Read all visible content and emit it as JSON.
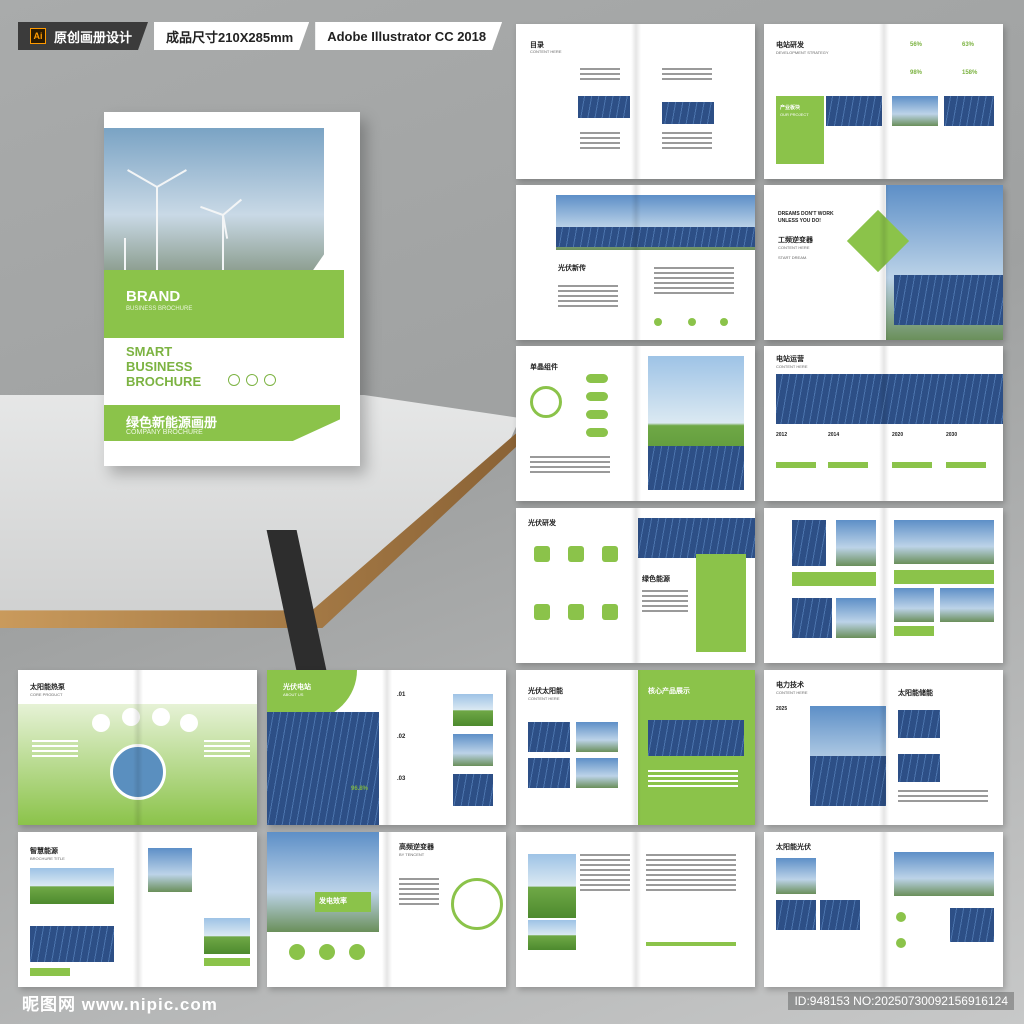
{
  "header": {
    "software_badge": "Ai",
    "tag_design": "原创画册设计",
    "tag_size": "成品尺寸210X285mm",
    "tag_software": "Adobe Illustrator CC 2018"
  },
  "cover": {
    "brand": "BRAND",
    "brand_sub": "BUSINESS BROCHURE",
    "title": "SMART BUSINESS BROCHURE",
    "title_cn": "绿色新能源画册",
    "title_cn_sub": "COMPANY BROCHURE"
  },
  "spreads": {
    "contents": {
      "title": "目录",
      "sub": "CONTENT HERE"
    },
    "research": {
      "title": "电站研发",
      "sub": "DEVELOPMENT STRATEGY",
      "pct1": "56%",
      "pct2": "63%",
      "pct3": "98%",
      "pct4": "158%",
      "project": "产业板块",
      "project_sub": "OUR PROJECT"
    },
    "culture": {
      "title": "光伏新传",
      "sub": "CORPORATE CULTURE"
    },
    "dreams": {
      "line1": "DREAMS DON'T WORK",
      "line2": "UNLESS YOU DO!",
      "title": "工频逆变器",
      "sub": "CONTENT HERE",
      "tail": "START DREAM."
    },
    "brand_org": {
      "title": "单晶组件",
      "sub1": "ENTERPISE",
      "sub2": "BRAND"
    },
    "station": {
      "title": "电站运营",
      "sub": "CONTENT HERE",
      "y1": "2012",
      "y2": "2014",
      "y3": "2020",
      "y4": "2030"
    },
    "services": {
      "title": "光伏研发",
      "sub": "OUR SERVICES",
      "green": "绿色能源"
    },
    "product": {
      "title": "太阳能热泵",
      "sub": "CORE PRODUCT"
    },
    "plant": {
      "title": "光伏电站",
      "sub": "ABOUT US",
      "n1": ".01",
      "n2": ".02",
      "n3": ".03",
      "stat": "96.8%"
    },
    "solar": {
      "title": "光伏太阳能",
      "sub": "CONTENT HERE",
      "right": "核心产品展示"
    },
    "power": {
      "title": "电力技术",
      "sub": "CONTENT HERE",
      "year": "2025",
      "right": "太阳能储能"
    },
    "smart": {
      "title": "智慧能源",
      "sub": "BROCHURE TITLE"
    },
    "efficiency": {
      "title": "发电效率",
      "right": "高频逆变器",
      "right_sub": "BY TENCENT"
    },
    "solar_pv": {
      "title": "太阳能光伏"
    }
  },
  "footer": {
    "site": "昵图网 www.nipic.com",
    "id": "ID:948153 NO:20250730092156916124"
  }
}
